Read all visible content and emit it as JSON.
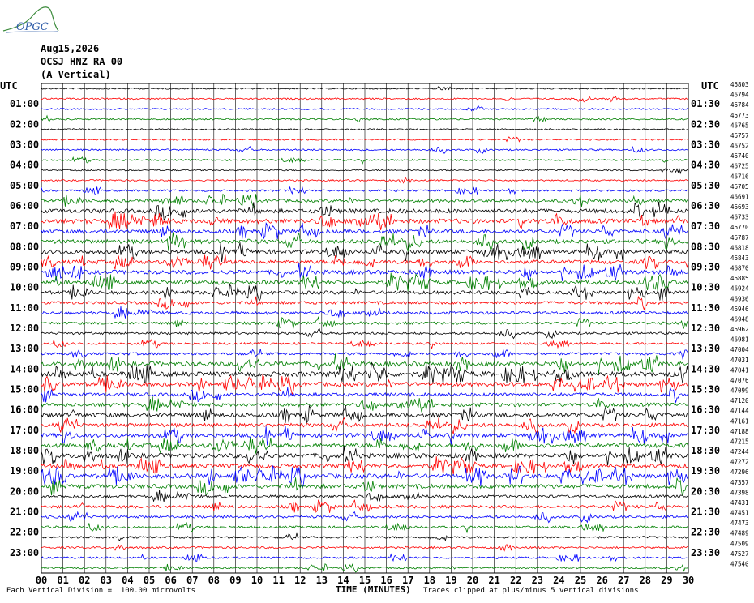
{
  "logo": {
    "text": "OPGC",
    "accent": "#2f5ca8",
    "curve_color": "#3a8a3a"
  },
  "header": {
    "date": "Aug15,2026",
    "station": "OCSJ HNZ RA 00",
    "component": "(A Vertical)",
    "left_tz": "UTC",
    "right_tz": "UTC"
  },
  "footer": {
    "vertical_division": "Each Vertical Division =  100.00 microvolts",
    "time_axis_label": "TIME (MINUTES)",
    "clip_note": "Traces clipped at plus/minus 5 vertical divisions"
  },
  "colors": {
    "cycle": [
      "#000000",
      "#ff0000",
      "#0000ff",
      "#008000"
    ],
    "grid": "#000000"
  },
  "chart_data": {
    "type": "line",
    "title": "Aug15,2026 OCSJ HNZ RA 00 (A Vertical)",
    "xlabel": "TIME (MINUTES)",
    "x_ticks": [
      "00",
      "01",
      "02",
      "03",
      "04",
      "05",
      "06",
      "07",
      "08",
      "09",
      "10",
      "11",
      "12",
      "13",
      "14",
      "15",
      "16",
      "17",
      "18",
      "19",
      "20",
      "21",
      "22",
      "23",
      "24",
      "25",
      "26",
      "27",
      "28",
      "29",
      "30"
    ],
    "xlim": [
      0,
      30
    ],
    "trace_minutes": 30,
    "grid": true,
    "left_hour_labels": [
      "01:00",
      "02:00",
      "03:00",
      "04:00",
      "05:00",
      "06:00",
      "07:00",
      "08:00",
      "09:00",
      "10:00",
      "11:00",
      "12:00",
      "13:00",
      "14:00",
      "15:00",
      "16:00",
      "17:00",
      "18:00",
      "19:00",
      "20:00",
      "21:00",
      "22:00",
      "23:00"
    ],
    "right_hour_labels": [
      "01:30",
      "02:30",
      "03:30",
      "04:30",
      "05:30",
      "06:30",
      "07:30",
      "08:30",
      "09:30",
      "10:30",
      "11:30",
      "12:30",
      "13:30",
      "14:30",
      "15:30",
      "16:30",
      "17:30",
      "18:30",
      "19:30",
      "20:30",
      "21:30",
      "22:30",
      "23:30"
    ],
    "right_counts": [
      "46803",
      "46794",
      "46784",
      "46773",
      "46765",
      "46757",
      "46752",
      "46740",
      "46725",
      "46716",
      "46705",
      "46691",
      "46693",
      "46733",
      "46770",
      "46787",
      "46818",
      "46843",
      "46870",
      "46885",
      "46924",
      "46936",
      "46946",
      "46948",
      "46962",
      "46981",
      "47004",
      "47031",
      "47041",
      "47076",
      "47099",
      "47120",
      "47144",
      "47161",
      "47188",
      "47215",
      "47244",
      "47272",
      "47296",
      "47357",
      "47398",
      "47431",
      "47451",
      "47473",
      "47489",
      "47509",
      "47527",
      "47540"
    ],
    "traces": {
      "count": 48,
      "activity": [
        0.2,
        0.25,
        0.25,
        0.3,
        0.25,
        0.25,
        0.35,
        0.3,
        0.25,
        0.3,
        0.5,
        1.0,
        1.6,
        1.8,
        1.4,
        1.6,
        1.6,
        1.4,
        1.6,
        1.6,
        1.3,
        1.0,
        1.0,
        0.8,
        0.7,
        0.6,
        0.8,
        1.8,
        2.0,
        1.6,
        1.2,
        1.4,
        1.6,
        1.4,
        1.6,
        1.6,
        1.8,
        1.6,
        1.8,
        1.6,
        1.0,
        1.0,
        0.8,
        0.7,
        0.6,
        0.5,
        0.5,
        0.4
      ]
    }
  }
}
